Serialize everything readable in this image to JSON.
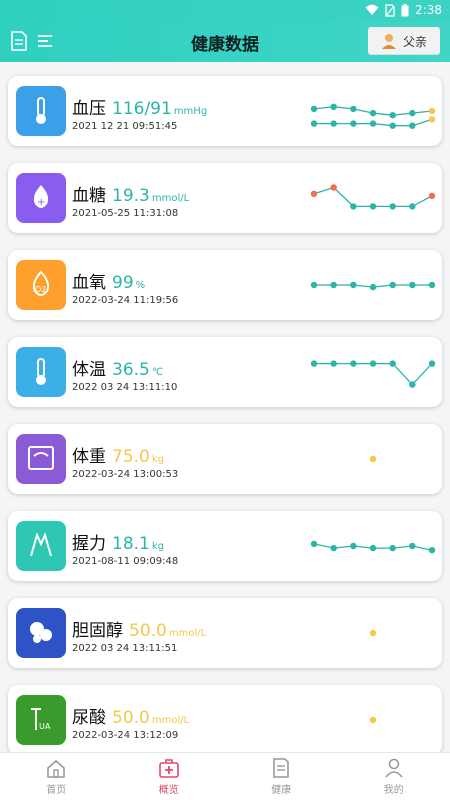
{
  "status": {
    "time": "2:38"
  },
  "header": {
    "title": "健康数据",
    "person": "父亲"
  },
  "cards": [
    {
      "name": "血压",
      "value": "116/91",
      "unit": "mmHg",
      "time": "2021 12 21 09:51:45",
      "value_color": "#2ab5a8",
      "icon": "thermometer-icon",
      "icon_color": "#3aa0e8"
    },
    {
      "name": "血糖",
      "value": "19.3",
      "unit": "mmol/L",
      "time": "2021-05-25 11:31:08",
      "value_color": "#2ab5a8",
      "icon": "blood-drop-icon",
      "icon_color": "#8a5cf0"
    },
    {
      "name": "血氧",
      "value": "99",
      "unit": "%",
      "time": "2022-03-24 11:19:56",
      "value_color": "#2ab5a8",
      "icon": "oxygen-icon",
      "icon_color": "#ff9f2e"
    },
    {
      "name": "体温",
      "value": "36.5",
      "unit": "℃",
      "time": "2022 03 24 13:11:10",
      "value_color": "#2ab5a8",
      "icon": "thermometer-icon",
      "icon_color": "#3bb0e8"
    },
    {
      "name": "体重",
      "value": "75.0",
      "unit": "kg",
      "time": "2022-03-24 13:00:53",
      "value_color": "#f2c94c",
      "icon": "scale-icon",
      "icon_color": "#8b5bd6"
    },
    {
      "name": "握力",
      "value": "18.1",
      "unit": "kg",
      "time": "2021-08-11 09:09:48",
      "value_color": "#2ab5a8",
      "icon": "grip-icon",
      "icon_color": "#2ec7b3"
    },
    {
      "name": "胆固醇",
      "value": "50.0",
      "unit": "mmol/L",
      "time": "2022 03 24 13:11:51",
      "value_color": "#f2c94c",
      "icon": "cholesterol-icon",
      "icon_color": "#2e53c7"
    },
    {
      "name": "尿酸",
      "value": "50.0",
      "unit": "mmol/L",
      "time": "2022-03-24 13:12:09",
      "value_color": "#f2c94c",
      "icon": "uric-acid-icon",
      "icon_color": "#3a9b2d"
    }
  ],
  "sparks": [
    {
      "series": [
        {
          "color": "#2ab5a8",
          "points": [
            0.55,
            0.6,
            0.55,
            0.45,
            0.4,
            0.45,
            0.5
          ]
        },
        {
          "color": "#2ab5a8",
          "points": [
            0.2,
            0.2,
            0.2,
            0.2,
            0.15,
            0.15,
            0.3
          ]
        }
      ],
      "highlight": "#f2c94c"
    },
    {
      "series": [
        {
          "color": "#2ab5a8",
          "points": [
            0.6,
            0.75,
            0.3,
            0.3,
            0.3,
            0.3,
            0.55
          ]
        }
      ],
      "endpoint_color": "#f07050"
    },
    {
      "series": [
        {
          "color": "#2ab5a8",
          "points": [
            0.5,
            0.5,
            0.5,
            0.45,
            0.5,
            0.5,
            0.5
          ]
        }
      ],
      "accent": "#e0507a"
    },
    {
      "series": [
        {
          "color": "#2ab5a8",
          "points": [
            0.7,
            0.7,
            0.7,
            0.7,
            0.7,
            0.2,
            0.7
          ]
        }
      ]
    },
    {
      "series": [
        {
          "color": "#f2c94c",
          "points": [
            null,
            null,
            null,
            0.5,
            null,
            null,
            null
          ]
        }
      ]
    },
    {
      "series": [
        {
          "color": "#2ab5a8",
          "points": [
            0.55,
            0.45,
            0.5,
            0.45,
            0.45,
            0.5,
            0.4
          ]
        }
      ],
      "accent": "#e08a3a"
    },
    {
      "series": [
        {
          "color": "#f2c94c",
          "points": [
            null,
            null,
            null,
            0.5,
            null,
            null,
            null
          ]
        }
      ]
    },
    {
      "series": [
        {
          "color": "#f2c94c",
          "points": [
            null,
            null,
            null,
            0.5,
            null,
            null,
            null
          ]
        }
      ]
    }
  ],
  "tabs": [
    {
      "label": "首页",
      "icon": "home-icon"
    },
    {
      "label": "概览",
      "icon": "medical-kit-icon"
    },
    {
      "label": "健康",
      "icon": "document-icon"
    },
    {
      "label": "我的",
      "icon": "person-icon"
    }
  ],
  "active_tab": 1
}
